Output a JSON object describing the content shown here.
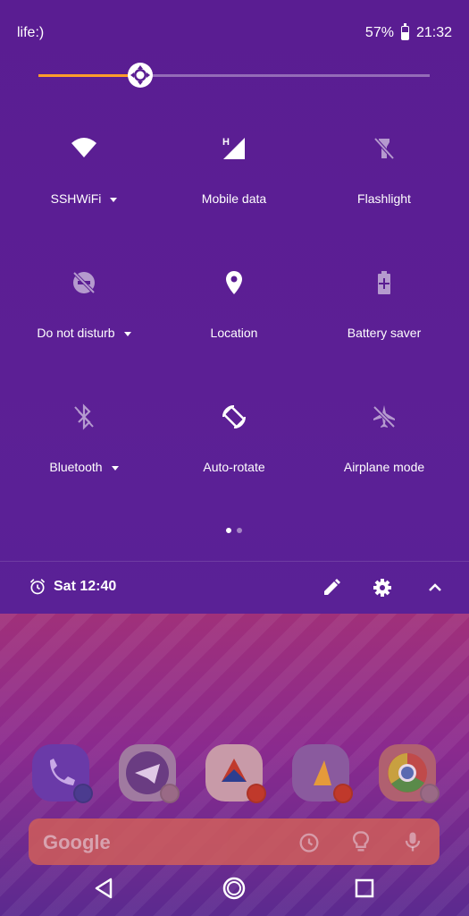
{
  "status_bar": {
    "carrier": "life:)",
    "battery_percent": "57%",
    "battery_level": 0.57,
    "time": "21:32"
  },
  "brightness": {
    "level": 0.26,
    "accent_color": "#ff9d2a"
  },
  "tiles": [
    {
      "label": "SSHWiFi",
      "icon": "wifi-icon",
      "has_menu": true,
      "active": true
    },
    {
      "label": "Mobile data",
      "icon": "mobile-data-icon",
      "has_menu": false,
      "active": true
    },
    {
      "label": "Flashlight",
      "icon": "flashlight-off-icon",
      "has_menu": false,
      "active": false
    },
    {
      "label": "Do not disturb",
      "icon": "dnd-off-icon",
      "has_menu": true,
      "active": false
    },
    {
      "label": "Location",
      "icon": "location-icon",
      "has_menu": false,
      "active": true
    },
    {
      "label": "Battery saver",
      "icon": "battery-saver-icon",
      "has_menu": false,
      "active": false
    },
    {
      "label": "Bluetooth",
      "icon": "bluetooth-off-icon",
      "has_menu": true,
      "active": false
    },
    {
      "label": "Auto-rotate",
      "icon": "auto-rotate-icon",
      "has_menu": false,
      "active": true
    },
    {
      "label": "Airplane mode",
      "icon": "airplane-off-icon",
      "has_menu": false,
      "active": false
    }
  ],
  "pager": {
    "pages": 2,
    "current": 1
  },
  "footer": {
    "alarm_text": "Sat 12:40"
  },
  "home": {
    "apps": [
      "Phone",
      "Telegram",
      "Assistant",
      "Music",
      "Chrome"
    ],
    "search_logo": "Google"
  }
}
